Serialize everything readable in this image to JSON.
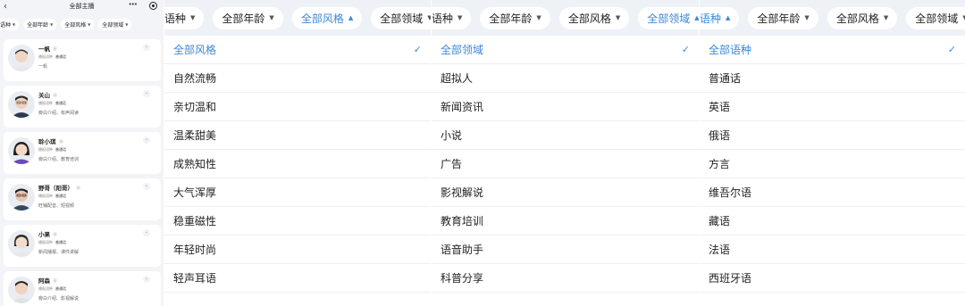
{
  "colors": {
    "accent": "#3d87d6",
    "bar_bg": "#eef2f7",
    "list_bg": "#f2f4f7"
  },
  "screen1": {
    "title": "全部主播",
    "back_icon": "‹",
    "more_icon": "•••",
    "filters": [
      {
        "label": "语种"
      },
      {
        "label": "全部年龄"
      },
      {
        "label": "全部风格"
      },
      {
        "label": "全部领域"
      }
    ],
    "anchors": [
      {
        "name": "一帆",
        "lang_label": "播报语种",
        "lang": "普通话",
        "desc": "一帆"
      },
      {
        "name": "关山",
        "lang_label": "播报语种",
        "lang": "普通话",
        "desc": "旁白介绍、有声阅读"
      },
      {
        "name": "聆小琪",
        "lang_label": "播报语种",
        "lang": "普通话",
        "desc": "旁白介绍、教育培训"
      },
      {
        "name": "野哥（阳哥）",
        "lang_label": "播报语种",
        "lang": "普通话",
        "desc": "旺铺配音、短视频"
      },
      {
        "name": "小果",
        "lang_label": "播报语种",
        "lang": "普通话",
        "desc": "新闻播报、课件讲解"
      },
      {
        "name": "阿森",
        "lang_label": "播报语种",
        "lang": "普通话",
        "desc": "旁白介绍、影视解说"
      }
    ]
  },
  "screen2": {
    "chips": [
      {
        "label": "语种"
      },
      {
        "label": "全部年龄"
      },
      {
        "label": "全部风格"
      },
      {
        "label": "全部领域"
      }
    ],
    "options": [
      "全部风格",
      "自然流畅",
      "亲切温和",
      "温柔甜美",
      "成熟知性",
      "大气浑厚",
      "稳重磁性",
      "年轻时尚",
      "轻声耳语"
    ],
    "selected_index": 0
  },
  "screen3": {
    "chips": [
      {
        "label": "语种"
      },
      {
        "label": "全部年龄"
      },
      {
        "label": "全部风格"
      },
      {
        "label": "全部领域"
      }
    ],
    "options": [
      "全部领域",
      "超拟人",
      "新闻资讯",
      "小说",
      "广告",
      "影视解说",
      "教育培训",
      "语音助手",
      "科普分享"
    ],
    "selected_index": 0
  },
  "screen4": {
    "chips": [
      {
        "label": "语种"
      },
      {
        "label": "全部年龄"
      },
      {
        "label": "全部风格"
      },
      {
        "label": "全部领域"
      }
    ],
    "options": [
      "全部语种",
      "普通话",
      "英语",
      "俄语",
      "方言",
      "维吾尔语",
      "藏语",
      "法语",
      "西班牙语"
    ],
    "selected_index": 0
  },
  "check_icon": "✓"
}
